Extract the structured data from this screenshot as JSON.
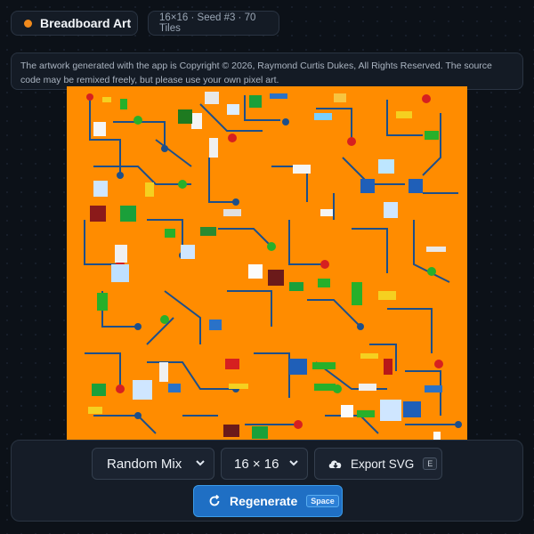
{
  "header": {
    "app_title": "Breadboard Art",
    "info": "16×16 · Seed #3 · 70 Tiles"
  },
  "notice": "The artwork generated with the app is Copyright © 2026, Raymond Curtis Dukes, All Rights Reserved. The source code may be remixed freely, but please use your own pixel art.",
  "controls": {
    "mode_value": "Random Mix",
    "grid_value": "16 × 16",
    "export_label": "Export SVG",
    "export_key": "E",
    "regenerate_label": "Regenerate",
    "regenerate_key": "Space"
  },
  "icons": {
    "status": "status-dot-icon",
    "mode_dropdown": "chevron-down-icon",
    "grid_dropdown": "chevron-down-icon",
    "export": "cloud-download-icon",
    "regenerate": "refresh-icon"
  },
  "colors": {
    "canvas_background": "#ff8c00",
    "trace": "#1d4f8a",
    "accent_orange": "#f08a1c",
    "primary_button": "#1f6fc4"
  },
  "grid": {
    "cols": 16,
    "rows": 16,
    "tiles": 70
  }
}
